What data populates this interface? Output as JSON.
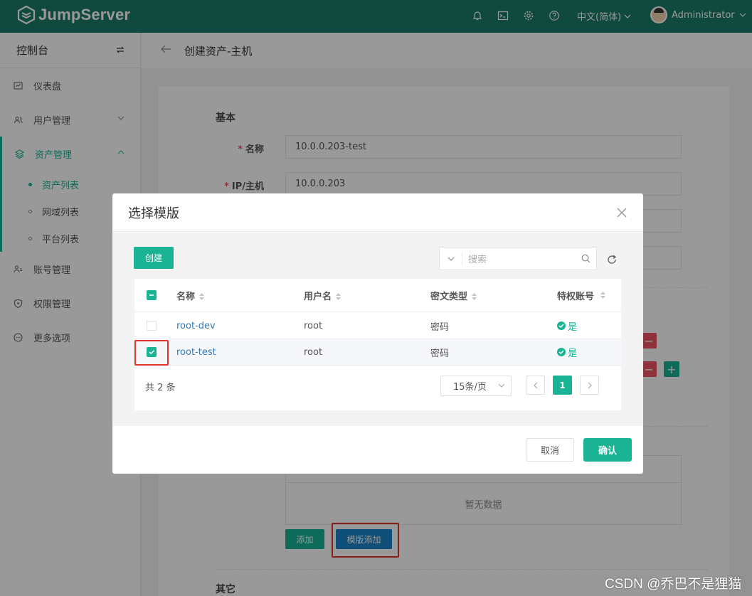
{
  "app": {
    "brand": "JumpServer"
  },
  "header": {
    "language": "中文(简体)",
    "user": "Administrator",
    "icons": [
      "bell-icon",
      "terminal-icon",
      "settings-icon",
      "help-icon"
    ]
  },
  "sidebar": {
    "title": "控制台",
    "items": [
      {
        "label": "仪表盘",
        "icon": "dashboard-icon"
      },
      {
        "label": "用户管理",
        "icon": "users-icon"
      },
      {
        "label": "资产管理",
        "icon": "assets-icon"
      },
      {
        "label": "账号管理",
        "icon": "accounts-icon"
      },
      {
        "label": "权限管理",
        "icon": "permissions-icon"
      },
      {
        "label": "更多选项",
        "icon": "more-icon"
      }
    ],
    "sub_items": [
      {
        "label": "资产列表"
      },
      {
        "label": "网域列表"
      },
      {
        "label": "平台列表"
      }
    ]
  },
  "page": {
    "title": "创建资产-主机",
    "section_basic": "基本",
    "section_other": "其它",
    "name_label": "名称",
    "name_value": "10.0.0.203-test",
    "ip_label": "IP/主机",
    "ip_value": "10.0.0.203",
    "empty_text": "暂无数据",
    "add_button": "添加",
    "template_add_button": "模版添加"
  },
  "modal": {
    "title": "选择模版",
    "create_button": "创建",
    "search_placeholder": "搜索",
    "columns": [
      "名称",
      "用户名",
      "密文类型",
      "特权账号"
    ],
    "rows": [
      {
        "name": "root-dev",
        "username": "root",
        "secret_type": "密码",
        "privileged": "是",
        "checked": false
      },
      {
        "name": "root-test",
        "username": "root",
        "secret_type": "密码",
        "privileged": "是",
        "checked": true
      }
    ],
    "total": "共 2 条",
    "page_size": "15条/页",
    "current_page": "1",
    "cancel_button": "取消",
    "confirm_button": "确认"
  },
  "watermark": "CSDN @乔巴不是狸猫",
  "colors": {
    "brand": "#1b7a67",
    "accent": "#1ab394",
    "danger": "#ed5565",
    "highlight": "#e0352b"
  }
}
